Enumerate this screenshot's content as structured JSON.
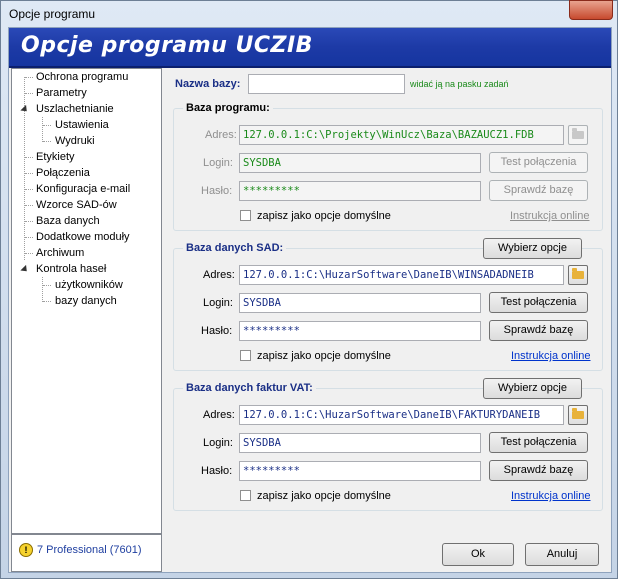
{
  "window": {
    "title": "Opcje programu"
  },
  "banner": {
    "title": "Opcje programu UCZIB"
  },
  "tree": {
    "items": [
      {
        "label": "Ochrona programu"
      },
      {
        "label": "Parametry"
      },
      {
        "label": "Uszlachetnianie"
      },
      {
        "label": "Ustawienia"
      },
      {
        "label": "Wydruki"
      },
      {
        "label": "Etykiety"
      },
      {
        "label": "Połączenia"
      },
      {
        "label": "Konfiguracja e-mail"
      },
      {
        "label": "Wzorce SAD-ów"
      },
      {
        "label": "Baza danych"
      },
      {
        "label": "Dodatkowe moduły"
      },
      {
        "label": "Archiwum"
      },
      {
        "label": "Kontrola haseł"
      },
      {
        "label": "użytkowników"
      },
      {
        "label": "bazy danych"
      }
    ]
  },
  "status": {
    "text": "7 Professional (7601)"
  },
  "db_name": {
    "label": "Nazwa bazy:",
    "value": "",
    "hint": "widać ją na pasku zadań"
  },
  "program_db": {
    "title": "Baza programu:",
    "address_label": "Adres:",
    "address_value": "127.0.0.1:C:\\Projekty\\WinUcz\\Baza\\BAZAUCZ1.FDB",
    "login_label": "Login:",
    "login_value": "SYSDBA",
    "password_label": "Hasło:",
    "password_value": "*********",
    "test_button": "Test połączenia",
    "check_button": "Sprawdź bazę",
    "default_checkbox": "zapisz jako opcje domyślne",
    "manual_link": "Instrukcja online"
  },
  "sad_db": {
    "title": "Baza danych SAD:",
    "options_button": "Wybierz opcje",
    "address_label": "Adres:",
    "address_value": "127.0.0.1:C:\\HuzarSoftware\\DaneIB\\WINSADADNEIB",
    "login_label": "Login:",
    "login_value": "SYSDBA",
    "password_label": "Hasło:",
    "password_value": "*********",
    "test_button": "Test połączenia",
    "check_button": "Sprawdź bazę",
    "default_checkbox": "zapisz jako opcje domyślne",
    "manual_link": "Instrukcja online"
  },
  "vat_db": {
    "title": "Baza danych faktur VAT:",
    "options_button": "Wybierz opcje",
    "address_label": "Adres:",
    "address_value": "127.0.0.1:C:\\HuzarSoftware\\DaneIB\\FAKTURYDANEIB",
    "login_label": "Login:",
    "login_value": "SYSDBA",
    "password_label": "Hasło:",
    "password_value": "*********",
    "test_button": "Test połączenia",
    "check_button": "Sprawdź bazę",
    "default_checkbox": "zapisz jako opcje domyślne",
    "manual_link": "Instrukcja online"
  },
  "footer": {
    "ok_button": "Ok",
    "cancel_button": "Anuluj"
  },
  "colors": {
    "banner": "#1d3aa6",
    "link": "#0033cc",
    "hint": "#1a8a1a",
    "folder": "#e8b23a"
  }
}
